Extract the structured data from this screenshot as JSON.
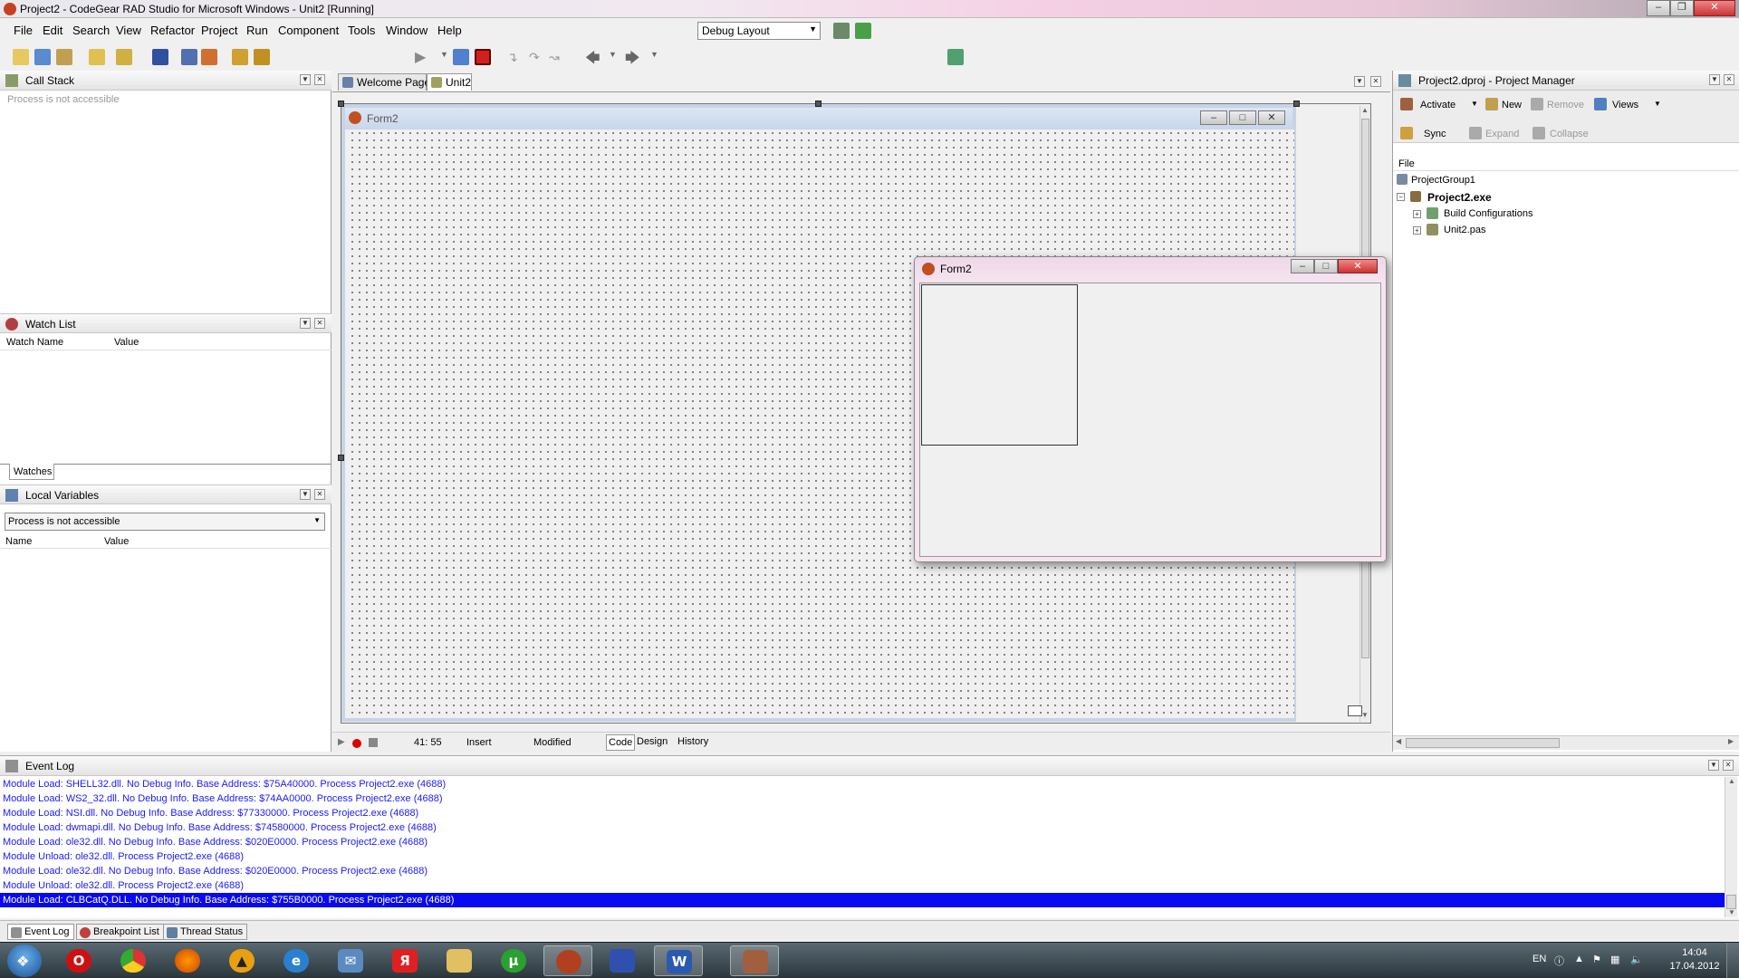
{
  "window": {
    "title": "Project2 - CodeGear RAD Studio for Microsoft Windows - Unit2 [Running]"
  },
  "menu": [
    "File",
    "Edit",
    "Search",
    "View",
    "Refactor",
    "Project",
    "Run",
    "Component",
    "Tools",
    "Window",
    "Help"
  ],
  "toolbar": {
    "layout": "Debug Layout"
  },
  "call_stack": {
    "title": "Call Stack",
    "message": "Process is not accessible"
  },
  "watch_list": {
    "title": "Watch List",
    "col_name": "Watch Name",
    "col_value": "Value",
    "tab": "Watches"
  },
  "local_vars": {
    "title": "Local Variables",
    "dropdown": "Process is not accessible",
    "col_name": "Name",
    "col_value": "Value"
  },
  "editor": {
    "tabs": [
      "Welcome Page",
      "Unit2"
    ],
    "form_caption": "Form2",
    "running_caption": "Form2",
    "status": {
      "position": "41: 55",
      "mode": "Insert",
      "state": "Modified"
    },
    "view_tabs": [
      "Code",
      "Design",
      "History"
    ]
  },
  "project_manager": {
    "title": "Project2.dproj - Project Manager",
    "activate": "Activate",
    "new": "New",
    "remove": "Remove",
    "views": "Views",
    "sync": "Sync",
    "expand": "Expand",
    "collapse": "Collapse",
    "col_file": "File",
    "tree": {
      "group": "ProjectGroup1",
      "project": "Project2.exe",
      "build": "Build Configurations",
      "unit": "Unit2.pas"
    }
  },
  "event_log": {
    "title": "Event Log",
    "lines": [
      "Module Load: SHELL32.dll. No Debug Info. Base Address: $75A40000. Process Project2.exe (4688)",
      "Module Load: WS2_32.dll. No Debug Info. Base Address: $74AA0000. Process Project2.exe (4688)",
      "Module Load: NSI.dll. No Debug Info. Base Address: $77330000. Process Project2.exe (4688)",
      "Module Load: dwmapi.dll. No Debug Info. Base Address: $74580000. Process Project2.exe (4688)",
      "Module Load: ole32.dll. No Debug Info. Base Address: $020E0000. Process Project2.exe (4688)",
      "Module Unload: ole32.dll. Process Project2.exe (4688)",
      "Module Load: ole32.dll. No Debug Info. Base Address: $020E0000. Process Project2.exe (4688)",
      "Module Unload: ole32.dll. Process Project2.exe (4688)",
      "Module Load: CLBCatQ.DLL. No Debug Info. Base Address: $755B0000. Process Project2.exe (4688)"
    ]
  },
  "bottom_tabs": [
    "Event Log",
    "Breakpoint List",
    "Thread Status"
  ],
  "taskbar": {
    "lang": "EN",
    "time": "14:04",
    "date": "17.04.2012"
  },
  "colors": {
    "selection": "#0a0af0",
    "log_text": "#1a1aff"
  }
}
